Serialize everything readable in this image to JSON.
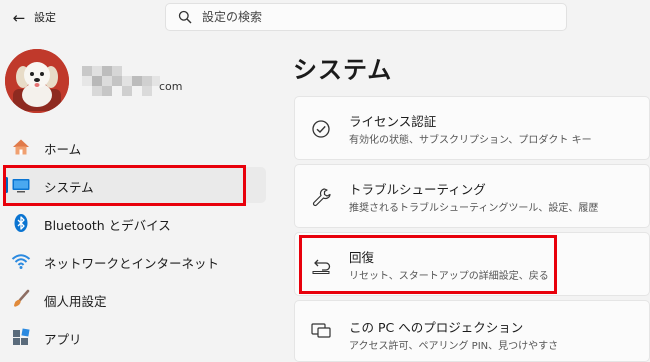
{
  "titlebar": {
    "app_title": "設定",
    "back_icon": "back-arrow-icon"
  },
  "search": {
    "placeholder": "設定の検索",
    "icon": "search-icon"
  },
  "account": {
    "email_domain": "com",
    "avatar": "dog-avatar"
  },
  "nav": {
    "items": [
      {
        "label": "ホーム",
        "icon": "home-icon",
        "selected": false
      },
      {
        "label": "システム",
        "icon": "monitor-icon",
        "selected": true
      },
      {
        "label": "Bluetooth とデバイス",
        "icon": "bluetooth-icon",
        "selected": false
      },
      {
        "label": "ネットワークとインターネット",
        "icon": "wifi-icon",
        "selected": false
      },
      {
        "label": "個人用設定",
        "icon": "brush-icon",
        "selected": false
      },
      {
        "label": "アプリ",
        "icon": "apps-icon",
        "selected": false
      }
    ]
  },
  "main": {
    "title": "システム",
    "cards": [
      {
        "title": "ライセンス認証",
        "desc": "有効化の状態、サブスクリプション、プロダクト キー",
        "icon": "check-circle-icon"
      },
      {
        "title": "トラブルシューティング",
        "desc": "推奨されるトラブルシューティングツール、設定、履歴",
        "icon": "wrench-icon"
      },
      {
        "title": "回復",
        "desc": "リセット、スタートアップの詳細設定、戻る",
        "icon": "recovery-icon"
      },
      {
        "title": "この PC へのプロジェクション",
        "desc": "アクセス許可、ペアリング PIN、見つけやすさ",
        "icon": "projection-icon"
      }
    ]
  },
  "colors": {
    "accent": "#0067c0",
    "highlight": "#e8000b",
    "background": "#f3f3f3"
  }
}
